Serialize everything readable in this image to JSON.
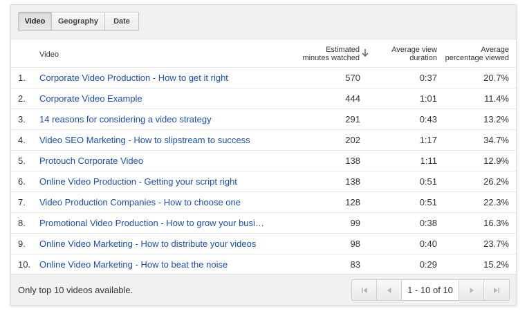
{
  "tabs": [
    {
      "label": "Video",
      "active": true
    },
    {
      "label": "Geography",
      "active": false
    },
    {
      "label": "Date",
      "active": false
    }
  ],
  "table": {
    "headers": {
      "video": "Video",
      "minutes_line1": "Estimated",
      "minutes_line2": "minutes watched",
      "duration_line1": "Average view",
      "duration_line2": "duration",
      "percentage_line1": "Average",
      "percentage_line2": "percentage viewed"
    },
    "sort_icon": "arrow-down-icon",
    "rows": [
      {
        "num": "1.",
        "title": "Corporate Video Production - How to get it right",
        "minutes": "570",
        "duration": "0:37",
        "percentage": "20.7%"
      },
      {
        "num": "2.",
        "title": "Corporate Video Example",
        "minutes": "444",
        "duration": "1:01",
        "percentage": "11.4%"
      },
      {
        "num": "3.",
        "title": "14 reasons for considering a video strategy",
        "minutes": "291",
        "duration": "0:43",
        "percentage": "13.2%"
      },
      {
        "num": "4.",
        "title": "Video SEO Marketing - How to slipstream to success",
        "minutes": "202",
        "duration": "1:17",
        "percentage": "34.7%"
      },
      {
        "num": "5.",
        "title": "Protouch Corporate Video",
        "minutes": "138",
        "duration": "1:11",
        "percentage": "12.9%"
      },
      {
        "num": "6.",
        "title": "Online Video Production - Getting your script right",
        "minutes": "138",
        "duration": "0:51",
        "percentage": "26.2%"
      },
      {
        "num": "7.",
        "title": "Video Production Companies - How to choose one",
        "minutes": "128",
        "duration": "0:51",
        "percentage": "22.3%"
      },
      {
        "num": "8.",
        "title": "Promotional Video Production - How to grow your busi…",
        "minutes": "99",
        "duration": "0:38",
        "percentage": "16.3%"
      },
      {
        "num": "9.",
        "title": "Online Video Marketing - How to distribute your videos",
        "minutes": "98",
        "duration": "0:40",
        "percentage": "23.7%"
      },
      {
        "num": "10.",
        "title": "Online Video Marketing - How to beat the noise",
        "minutes": "83",
        "duration": "0:29",
        "percentage": "15.2%"
      }
    ]
  },
  "footer": {
    "note": "Only top 10 videos available.",
    "range": "1 - 10 of 10",
    "icons": [
      "first-page-icon",
      "previous-page-icon",
      "next-page-icon",
      "last-page-icon"
    ]
  },
  "colors": {
    "link": "#1a4fb0",
    "toolbar_bg": "#f1f1f1",
    "icon_gray": "#b5b5b5"
  }
}
